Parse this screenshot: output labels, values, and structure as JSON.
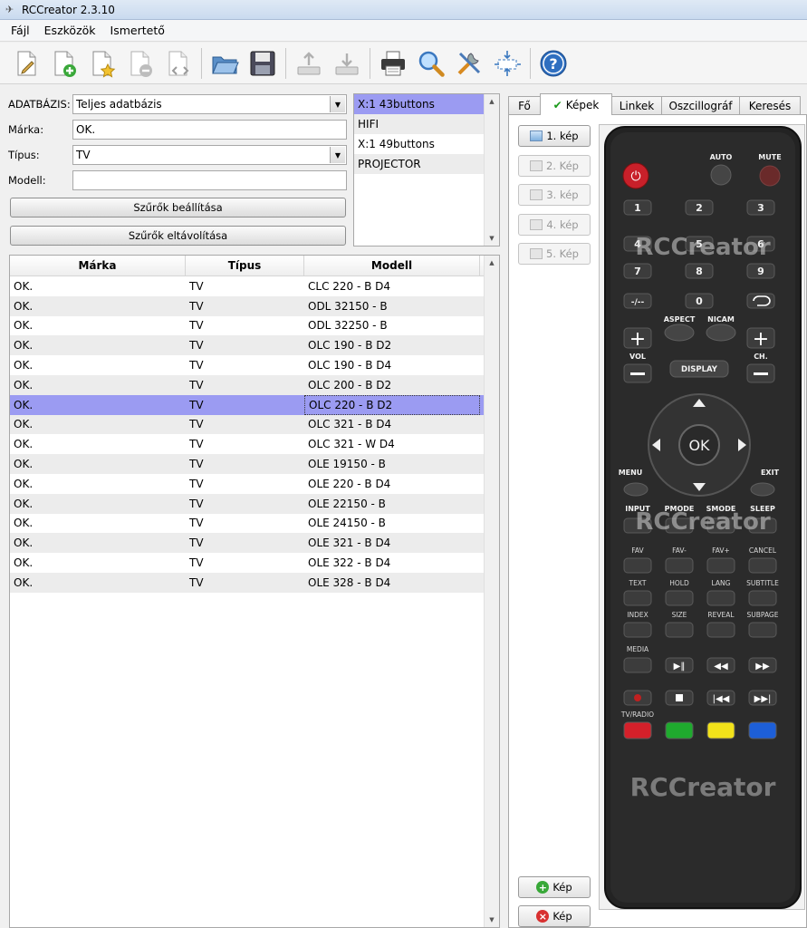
{
  "window": {
    "title": "RCCreator 2.3.10"
  },
  "menu": [
    "Fájl",
    "Eszközök",
    "Ismertető"
  ],
  "toolbar": {
    "icons": [
      "new-file-icon",
      "add-file-icon",
      "favorite-file-icon",
      "remove-file-icon",
      "code-file-icon",
      "open-folder-icon",
      "save-icon",
      "upload-icon",
      "download-icon",
      "print-icon",
      "search-icon",
      "tools-icon",
      "resize-icon",
      "help-icon"
    ]
  },
  "filters": {
    "database_label": "ADATBÁZIS:",
    "database_value": "Teljes adatbázis",
    "brand_label": "Márka:",
    "brand_value": "OK.",
    "type_label": "Típus:",
    "type_value": "TV",
    "model_label": "Modell:",
    "model_value": "",
    "set_filters": "Szűrők beállítása",
    "remove_filters": "Szűrők eltávolítása"
  },
  "button_sets": [
    {
      "label": "X:1 43buttons",
      "selected": true
    },
    {
      "label": "HIFI"
    },
    {
      "label": "X:1 49buttons"
    },
    {
      "label": "PROJECTOR"
    }
  ],
  "table": {
    "headers": [
      "Márka",
      "Típus",
      "Modell"
    ],
    "rows": [
      [
        "OK.",
        "TV",
        "CLC 220 - B D4"
      ],
      [
        "OK.",
        "TV",
        "ODL 32150 - B"
      ],
      [
        "OK.",
        "TV",
        "ODL 32250 - B"
      ],
      [
        "OK.",
        "TV",
        "OLC 190 - B D2"
      ],
      [
        "OK.",
        "TV",
        "OLC 190 - B D4"
      ],
      [
        "OK.",
        "TV",
        "OLC 200 - B D2"
      ],
      [
        "OK.",
        "TV",
        "OLC 220 - B D2"
      ],
      [
        "OK.",
        "TV",
        "OLC 321 - B D4"
      ],
      [
        "OK.",
        "TV",
        "OLC 321 - W D4"
      ],
      [
        "OK.",
        "TV",
        "OLE 19150 - B"
      ],
      [
        "OK.",
        "TV",
        "OLE 220 - B D4"
      ],
      [
        "OK.",
        "TV",
        "OLE 22150 - B"
      ],
      [
        "OK.",
        "TV",
        "OLE 24150 - B"
      ],
      [
        "OK.",
        "TV",
        "OLE 321 - B D4"
      ],
      [
        "OK.",
        "TV",
        "OLE 322 - B D4"
      ],
      [
        "OK.",
        "TV",
        "OLE 328 - B D4"
      ]
    ],
    "selected_row": 6
  },
  "tabs": {
    "items": [
      "Fő",
      "Képek",
      "Linkek",
      "Oszcillográf",
      "Keresés"
    ],
    "active": 1
  },
  "image_buttons": [
    "1. kép",
    "2. Kép",
    "3. kép",
    "4. kép",
    "5. Kép"
  ],
  "add_image": "Kép",
  "delete_image": "Kép",
  "remote": {
    "watermark": "RCCreator",
    "labels": {
      "auto": "AUTO",
      "mute": "MUTE",
      "n1": "1",
      "n2": "2",
      "n3": "3",
      "n4": "4",
      "n5": "5",
      "n6": "6",
      "n7": "7",
      "n8": "8",
      "n9": "9",
      "dash": "-/--",
      "n0": "0",
      "aspect": "ASPECT",
      "nicam": "NICAM",
      "vol": "VOL",
      "ch": "CH.",
      "display": "DISPLAY",
      "ok": "OK",
      "menu": "MENU",
      "exit": "EXIT",
      "input": "INPUT",
      "pmode": "PMODE",
      "smode": "SMODE",
      "sleep": "SLEEP",
      "fav": "FAV",
      "favm": "FAV-",
      "favp": "FAV+",
      "cancel": "CANCEL",
      "text": "TEXT",
      "hold": "HOLD",
      "lang": "LANG",
      "subtitle": "SUBTITLE",
      "index": "INDEX",
      "size": "SIZE",
      "reveal": "REVEAL",
      "subpage": "SUBPAGE",
      "media": "MEDIA",
      "tvradio": "TV/RADIO"
    },
    "colors": {
      "red": "#d4202a",
      "green": "#1faa2e",
      "yellow": "#f2e21a",
      "blue": "#1d5fd8",
      "power": "#c8202a"
    }
  }
}
